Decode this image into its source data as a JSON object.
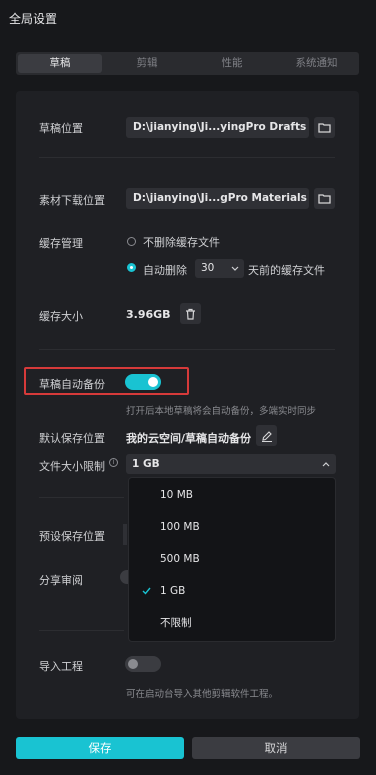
{
  "window": {
    "title": "全局设置"
  },
  "tabs": [
    {
      "label": "草稿",
      "active": true
    },
    {
      "label": "剪辑",
      "active": false
    },
    {
      "label": "性能",
      "active": false
    },
    {
      "label": "系统通知",
      "active": false
    }
  ],
  "drafts": {
    "location_label": "草稿位置",
    "location_value": "D:\\jianying\\Ji...yingPro Drafts",
    "download_label": "素材下载位置",
    "download_value": "D:\\jianying\\Ji...gPro Materials",
    "cache_label": "缓存管理",
    "cache_option_keep": "不删除缓存文件",
    "cache_option_auto": "自动删除",
    "cache_days": "30",
    "cache_suffix": "天前的缓存文件",
    "cache_size_label": "缓存大小",
    "cache_size_value": "3.96GB"
  },
  "backup": {
    "label": "草稿自动备份",
    "enabled": true,
    "hint": "打开后本地草稿将会自动备份，多端实时同步",
    "save_location_label": "默认保存位置",
    "save_location_value": "我的云空间/草稿自动备份",
    "size_limit_label": "文件大小限制",
    "size_limit_value": "1 GB",
    "size_options": [
      {
        "label": "10 MB",
        "selected": false
      },
      {
        "label": "100 MB",
        "selected": false
      },
      {
        "label": "500 MB",
        "selected": false
      },
      {
        "label": "1 GB",
        "selected": true
      },
      {
        "label": "不限制",
        "selected": false
      }
    ]
  },
  "preset": {
    "label": "预设保存位置"
  },
  "share": {
    "label": "分享审阅"
  },
  "import": {
    "label": "导入工程",
    "enabled": false,
    "hint": "可在启动台导入其他剪辑软件工程。"
  },
  "footer": {
    "save_label": "保存",
    "cancel_label": "取消"
  },
  "colors": {
    "accent": "#19c3d2",
    "highlight": "#d63a3a"
  }
}
